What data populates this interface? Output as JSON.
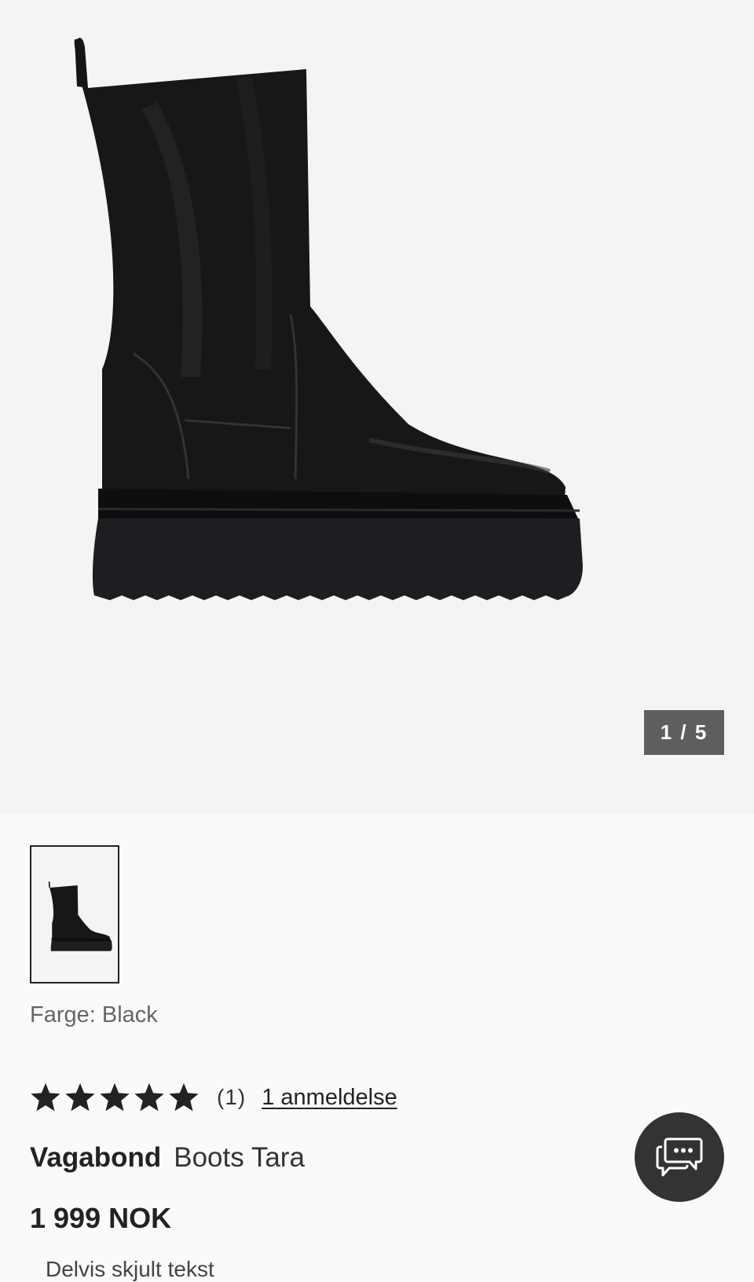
{
  "gallery": {
    "counter": "1 / 5",
    "image_alt": "Vagabond Boots Tara",
    "thumbnail_alt": "Vagabond Boots Tara thumbnail"
  },
  "product": {
    "color_label": "Farge: Black",
    "rating_stars": 5,
    "rating_count": "(1)",
    "review_link": "1 anmeldelse",
    "brand": "Vagabond",
    "name": "Boots Tara",
    "price": "1 999 NOK",
    "partial_text": "Delvis skjult tekst"
  },
  "chat": {
    "icon": "chat-bubbles-icon"
  },
  "colors": {
    "hero_bg": "#f4f4f4",
    "page_bg": "#fafafa",
    "counter_bg": "#5e5e5e",
    "chat_bg": "#333333"
  }
}
